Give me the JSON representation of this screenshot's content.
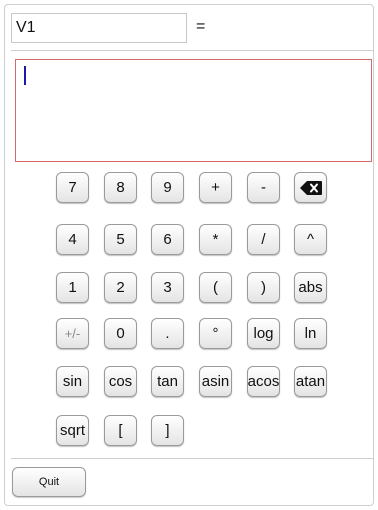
{
  "variable": {
    "value": "V1"
  },
  "equals_label": "=",
  "expression": {
    "value": ""
  },
  "keys": {
    "k7": "7",
    "k8": "8",
    "k9": "9",
    "plus": "+",
    "minus": "-",
    "k4": "4",
    "k5": "5",
    "k6": "6",
    "multiply": "*",
    "divide": "/",
    "power": "^",
    "k1": "1",
    "k2": "2",
    "k3": "3",
    "lparen": "(",
    "rparen": ")",
    "abs": "abs",
    "negate": "+/-",
    "k0": "0",
    "dot": ".",
    "degree": "°",
    "log": "log",
    "ln": "ln",
    "sin": "sin",
    "cos": "cos",
    "tan": "tan",
    "asin": "asin",
    "acos": "acos",
    "atan": "atan",
    "sqrt": "sqrt",
    "lbracket": "[",
    "rbracket": "]"
  },
  "backspace_icon": "backspace-icon",
  "quit_label": "Quit"
}
